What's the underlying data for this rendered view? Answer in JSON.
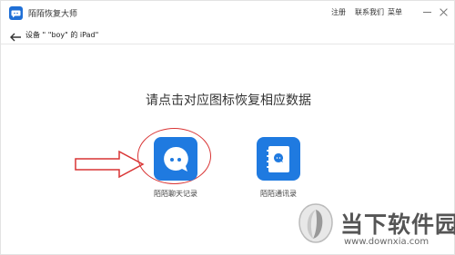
{
  "app": {
    "title": "陌陌恢复大师",
    "icon": "app-logo-icon"
  },
  "menu": {
    "register": "注册",
    "contact_us": "联系我们",
    "menu_label": "菜单"
  },
  "breadcrumb": {
    "text": "设备 \" \"boy\" 的 iPad\""
  },
  "main": {
    "heading": "请点击对应图标恢复相应数据"
  },
  "options": [
    {
      "label": "陌陌聊天记录",
      "icon": "chat-bubble-icon"
    },
    {
      "label": "陌陌通讯录",
      "icon": "contacts-book-icon"
    }
  ],
  "watermark": {
    "brand": "当下软件园",
    "url": "www.downxia.com"
  },
  "colors": {
    "accent": "#1f7ae0",
    "highlight": "#d93434"
  }
}
